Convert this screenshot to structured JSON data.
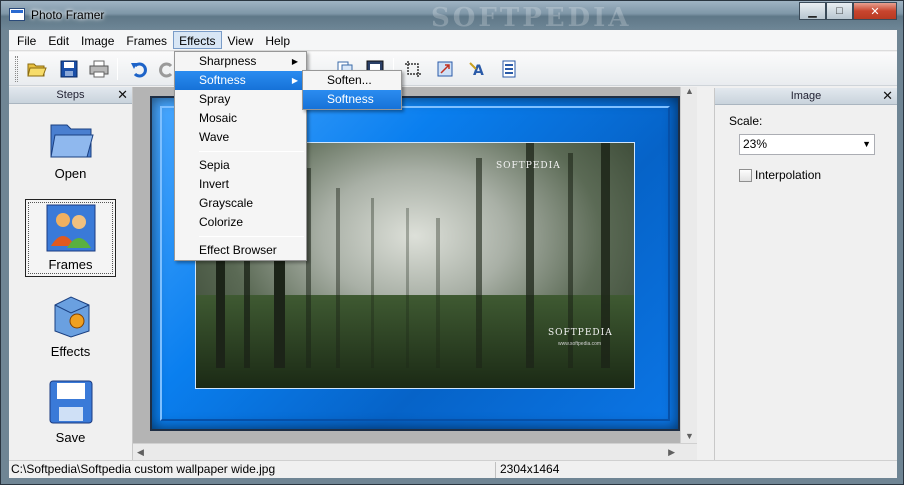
{
  "window": {
    "title": "Photo Framer",
    "watermark": "SOFTPEDIA",
    "buttons": {
      "minimize": "▁",
      "maximize": "□",
      "close": "✕"
    }
  },
  "menubar": [
    "File",
    "Edit",
    "Image",
    "Frames",
    "Effects",
    "View",
    "Help"
  ],
  "effects_menu": {
    "items": [
      "Sharpness",
      "Softness",
      "Spray",
      "Mosaic",
      "Wave",
      "Sepia",
      "Invert",
      "Grayscale",
      "Colorize",
      "Effect Browser"
    ]
  },
  "softness_submenu": {
    "items": [
      "Soften...",
      "Softness"
    ]
  },
  "steps_panel": {
    "title": "Steps",
    "close": "✕",
    "steps": [
      "Open",
      "Frames",
      "Effects",
      "Save"
    ]
  },
  "image_panel": {
    "title": "Image",
    "close": "✕",
    "scale_label": "Scale:",
    "scale_value": "23%",
    "interpolation_label": "Interpolation"
  },
  "photo": {
    "watermark1": "SOFTPEDIA",
    "watermark2": "SOFTPEDIA",
    "watermark3": "www.softpedia.com"
  },
  "statusbar": {
    "path": "C:\\Softpedia\\Softpedia custom wallpaper wide.jpg",
    "dimensions": "2304x1464"
  },
  "icons": {
    "toolbar": [
      "open-folder-icon",
      "save-icon",
      "print-icon",
      "undo-icon",
      "redo-icon",
      "copy-icon",
      "crop-icon",
      "frame-icon",
      "resize-icon",
      "text-icon",
      "info-icon"
    ]
  },
  "colors": {
    "frame_blue": "#0a7fef",
    "menu_highlight": "#1672d8"
  }
}
